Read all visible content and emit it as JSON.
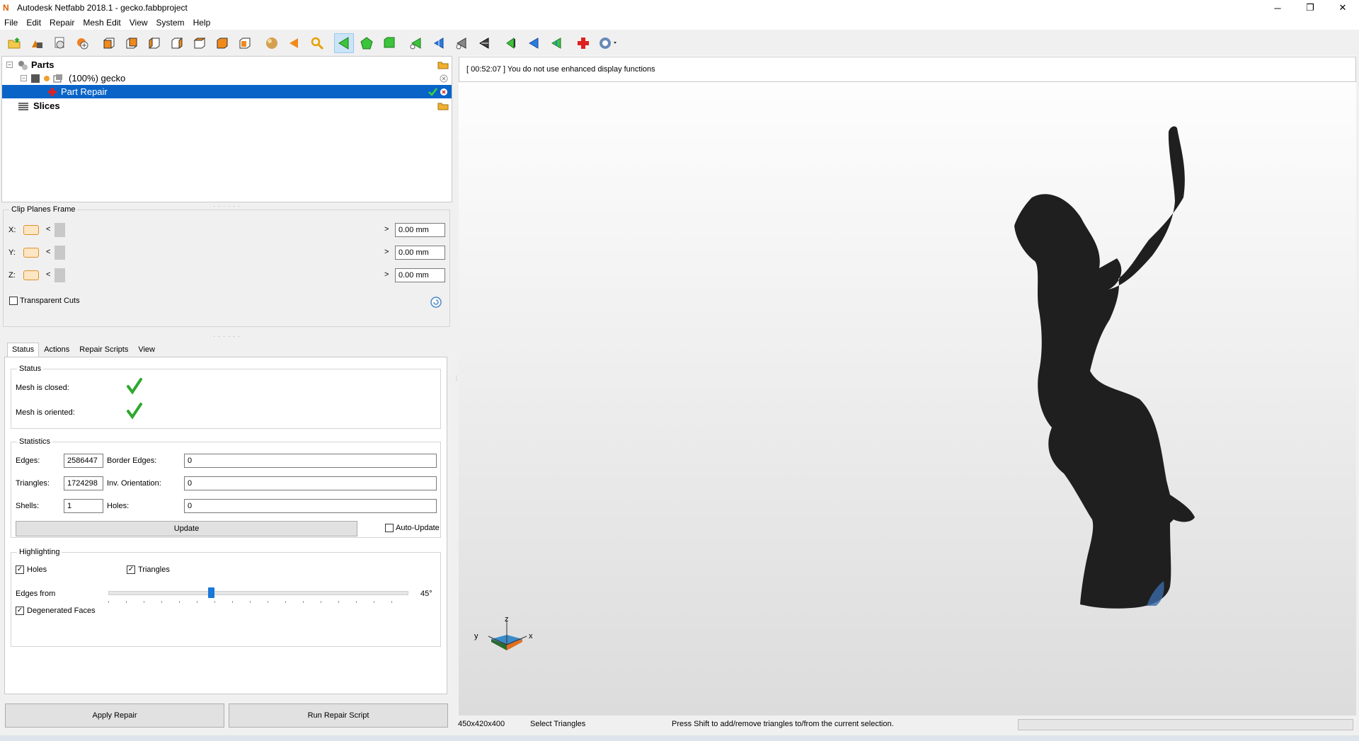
{
  "window": {
    "title": "Autodesk Netfabb 2018.1 - gecko.fabbproject",
    "controls": {
      "minimize": "─",
      "maximize": "❐",
      "close": "✕"
    }
  },
  "menu": [
    "File",
    "Edit",
    "Repair",
    "Mesh Edit",
    "View",
    "System",
    "Help"
  ],
  "toolbar": {
    "icons": [
      "open-project-icon",
      "add-part-icon",
      "settings-icon",
      "add-icon",
      "view-front-icon",
      "view-back-icon",
      "view-left-icon",
      "view-right-icon",
      "view-top-icon",
      "view-bottom-icon",
      "view-iso-icon",
      "sphere-icon",
      "arrow-left-icon",
      "zoom-icon",
      "select-triangles-icon",
      "select-surfaces-icon",
      "select-shells-icon",
      "add-triangle-icon",
      "triangle-tool-2-icon",
      "triangle-tool-3-icon",
      "triangle-tool-4-icon",
      "prev-green-icon",
      "prev-blue-icon",
      "next-green-icon",
      "repair-cross-icon",
      "help-icon"
    ]
  },
  "tree": {
    "parts_label": "Parts",
    "part_label": "(100%) gecko",
    "repair_label": "Part Repair",
    "slices_label": "Slices"
  },
  "clip": {
    "title": "Clip Planes Frame",
    "rows": [
      {
        "axis": "X:",
        "value": "0.00 mm"
      },
      {
        "axis": "Y:",
        "value": "0.00 mm"
      },
      {
        "axis": "Z:",
        "value": "0.00 mm"
      }
    ],
    "left_arrow": "<",
    "right_arrow": ">",
    "transparent_label": "Transparent Cuts"
  },
  "tabs": [
    "Status",
    "Actions",
    "Repair Scripts",
    "View"
  ],
  "status": {
    "group_title": "Status",
    "closed_label": "Mesh is closed:",
    "oriented_label": "Mesh is oriented:"
  },
  "statistics": {
    "group_title": "Statistics",
    "edges_label": "Edges:",
    "edges_value": "2586447",
    "border_edges_label": "Border Edges:",
    "border_edges_value": "0",
    "triangles_label": "Triangles:",
    "triangles_value": "1724298",
    "inv_orientation_label": "Inv. Orientation:",
    "inv_orientation_value": "0",
    "shells_label": "Shells:",
    "shells_value": "1",
    "holes_label": "Holes:",
    "holes_value": "0",
    "update_button": "Update",
    "auto_update_label": "Auto-Update"
  },
  "highlighting": {
    "group_title": "Highlighting",
    "holes_label": "Holes",
    "triangles_label": "Triangles",
    "edges_from_label": "Edges from",
    "edges_value": "45°",
    "edges_level": 0.34,
    "degenerated_label": "Degenerated Faces"
  },
  "buttons": {
    "apply_repair": "Apply Repair",
    "run_repair_script": "Run Repair Script"
  },
  "viewport": {
    "message": "[ 00:52:07 ] You do not use enhanced display functions",
    "axis_x": "x",
    "axis_y": "y",
    "axis_z": "z"
  },
  "statusbar": {
    "dimensions": "450x420x400",
    "mode": "Select Triangles",
    "hint": "Press Shift to add/remove triangles to/from the current selection."
  },
  "colors": {
    "selection": "#0a64c8",
    "model": "#1f1f1f",
    "check": "#2ea82e"
  }
}
